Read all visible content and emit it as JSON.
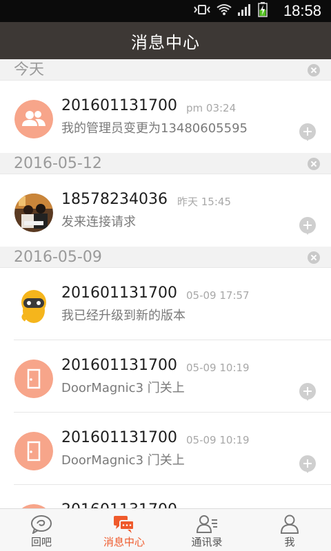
{
  "status_bar": {
    "time": "18:58",
    "icons": [
      "vibrate-icon",
      "wifi-icon",
      "signal-icon",
      "battery-charging-icon"
    ]
  },
  "header": {
    "title": "消息中心"
  },
  "sections": [
    {
      "date": "今天",
      "items": [
        {
          "sender": "201601131700",
          "time": "pm 03:24",
          "text": "我的管理员变更为13480605595",
          "avatar": "group-icon"
        }
      ]
    },
    {
      "date": "2016-05-12",
      "items": [
        {
          "sender": "18578234036",
          "time": "昨天 15:45",
          "text": "发来连接请求",
          "avatar": "user-photo"
        }
      ]
    },
    {
      "date": "2016-05-09",
      "items": [
        {
          "sender": "201601131700",
          "time": "05-09 17:57",
          "text": "我已经升级到新的版本",
          "avatar": "robot-icon"
        },
        {
          "sender": "201601131700",
          "time": "05-09 10:19",
          "text": "DoorMagnic3 门关上",
          "avatar": "door-icon"
        },
        {
          "sender": "201601131700",
          "time": "05-09 10:19",
          "text": "DoorMagnic3 门关上",
          "avatar": "door-icon"
        },
        {
          "sender": "201601131700",
          "time": "",
          "text": "",
          "avatar": "door-icon"
        }
      ]
    }
  ],
  "bottom_nav": [
    {
      "label": "回吧",
      "icon": "chat-bubble-icon",
      "active": false
    },
    {
      "label": "消息中心",
      "icon": "messages-icon",
      "active": true
    },
    {
      "label": "通讯录",
      "icon": "contacts-icon",
      "active": false
    },
    {
      "label": "我",
      "icon": "profile-icon",
      "active": false
    }
  ],
  "colors": {
    "header_bg": "#3d3835",
    "accent": "#ef5a2c",
    "avatar_orange": "#f7a58a"
  }
}
